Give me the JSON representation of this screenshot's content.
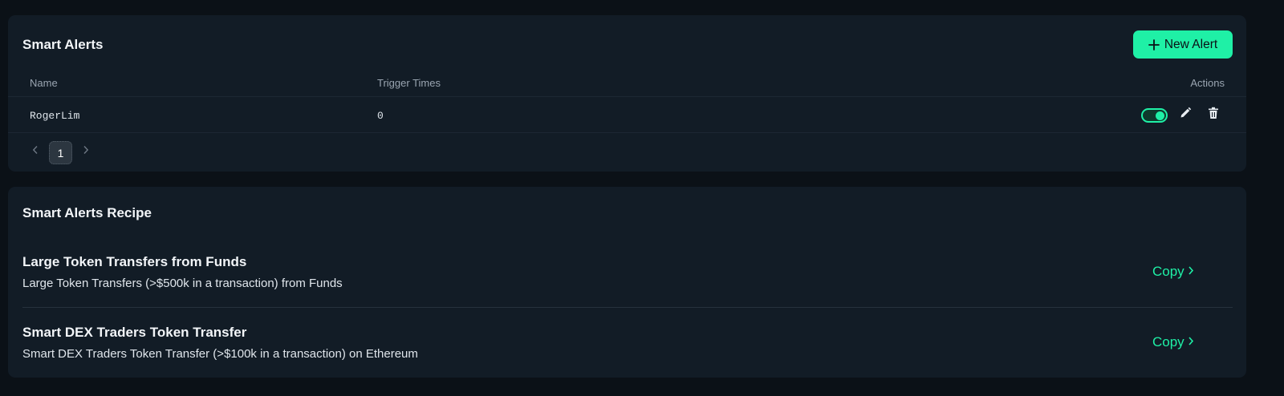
{
  "smart_alerts": {
    "title": "Smart Alerts",
    "new_alert_label": "New Alert",
    "columns": {
      "name": "Name",
      "trigger_times": "Trigger Times",
      "actions": "Actions"
    },
    "rows": [
      {
        "name": "RogerLim",
        "trigger_times": "0",
        "enabled": true
      }
    ],
    "pagination": {
      "current_page": "1"
    }
  },
  "recipes": {
    "title": "Smart Alerts Recipe",
    "items": [
      {
        "title": "Large Token Transfers from Funds",
        "description": "Large Token Transfers (>$500k in a transaction) from Funds",
        "action_label": "Copy"
      },
      {
        "title": "Smart DEX Traders Token Transfer",
        "description": "Smart DEX Traders Token Transfer (>$100k in a transaction) on Ethereum",
        "action_label": "Copy"
      }
    ]
  },
  "colors": {
    "accent": "#1ff0a6",
    "background": "#0b1117",
    "card": "#121c26"
  },
  "icons": [
    "plus-icon",
    "chevron-left-icon",
    "chevron-right-icon",
    "pencil-icon",
    "trash-icon"
  ]
}
